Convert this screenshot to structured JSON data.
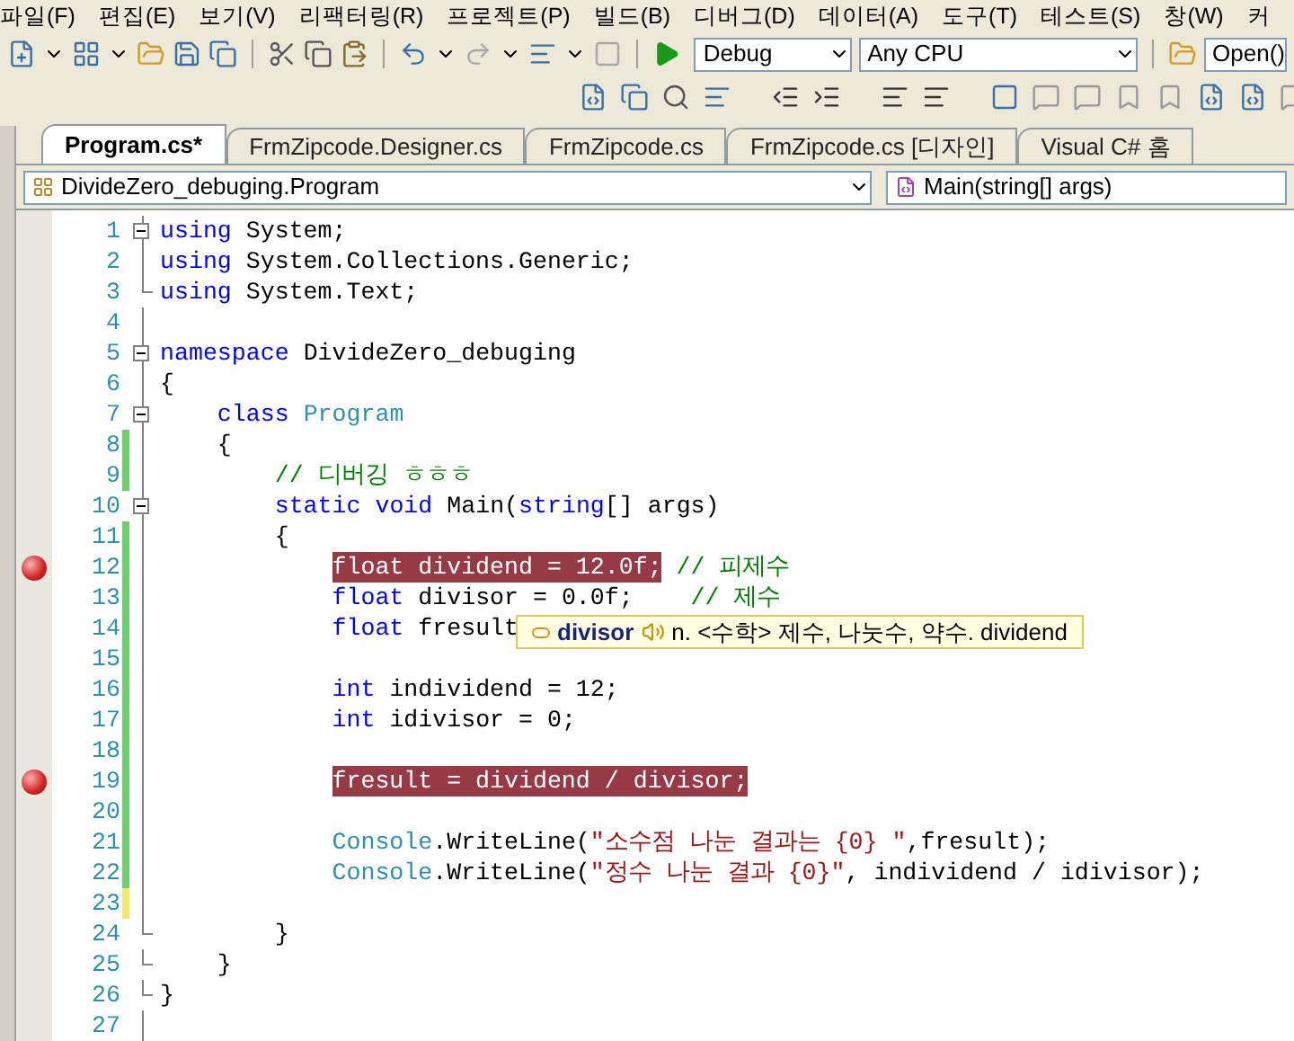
{
  "menu": [
    "파일(F)",
    "편집(E)",
    "보기(V)",
    "리팩터링(R)",
    "프로젝트(P)",
    "빌드(B)",
    "디버그(D)",
    "데이터(A)",
    "도구(T)",
    "테스트(S)",
    "창(W)",
    "커"
  ],
  "toolbar": {
    "configuration": "Debug",
    "platform": "Any CPU",
    "find_value": "Open()"
  },
  "tabs": [
    {
      "label": "Program.cs*",
      "selected": true
    },
    {
      "label": "FrmZipcode.Designer.cs",
      "selected": false
    },
    {
      "label": "FrmZipcode.cs",
      "selected": false
    },
    {
      "label": "FrmZipcode.cs [디자인]",
      "selected": false
    },
    {
      "label": "Visual C# 홈",
      "selected": false
    }
  ],
  "navigation": {
    "type": "DivideZero_debuging.Program",
    "member": "Main(string[] args)"
  },
  "lines": [
    {
      "number": "1",
      "collapsible": true,
      "block_end": false,
      "changed": false,
      "breakpoint": false,
      "tokens": [
        {
          "kind": "keyword",
          "text": "using"
        },
        {
          "kind": "plain",
          "text": " System;"
        }
      ]
    },
    {
      "number": "2",
      "collapsible": false,
      "block_end": false,
      "changed": false,
      "breakpoint": false,
      "tokens": [
        {
          "kind": "keyword",
          "text": "using"
        },
        {
          "kind": "plain",
          "text": " System.Collections.Generic;"
        }
      ]
    },
    {
      "number": "3",
      "collapsible": false,
      "block_end": true,
      "changed": false,
      "breakpoint": false,
      "tokens": [
        {
          "kind": "keyword",
          "text": "using"
        },
        {
          "kind": "plain",
          "text": " System.Text;"
        }
      ]
    },
    {
      "number": "4",
      "collapsible": false,
      "block_end": false,
      "changed": false,
      "breakpoint": false
    },
    {
      "number": "5",
      "collapsible": true,
      "block_end": false,
      "changed": false,
      "breakpoint": false,
      "tokens": [
        {
          "kind": "keyword",
          "text": "namespace"
        },
        {
          "kind": "plain",
          "text": " DivideZero_debuging"
        }
      ]
    },
    {
      "number": "6",
      "collapsible": false,
      "block_end": false,
      "changed": false,
      "breakpoint": false,
      "tokens": [
        {
          "kind": "plain",
          "text": "{"
        }
      ]
    },
    {
      "number": "7",
      "collapsible": true,
      "block_end": false,
      "changed": false,
      "breakpoint": false,
      "tokens": [
        {
          "kind": "keyword",
          "text": "    class"
        },
        {
          "kind": "type",
          "text": " Program"
        }
      ]
    },
    {
      "number": "8",
      "collapsible": false,
      "block_end": false,
      "changed": true,
      "saved": true,
      "breakpoint": false,
      "tokens": [
        {
          "kind": "plain",
          "text": "    {"
        }
      ]
    },
    {
      "number": "9",
      "collapsible": false,
      "block_end": false,
      "changed": true,
      "saved": true,
      "breakpoint": false,
      "tokens": [
        {
          "kind": "comment",
          "text": "        // 디버깅 ㅎㅎㅎ"
        }
      ]
    },
    {
      "number": "10",
      "collapsible": true,
      "block_end": false,
      "changed": false,
      "breakpoint": false,
      "tokens": [
        {
          "kind": "keyword",
          "text": "        static"
        },
        {
          "kind": "keyword",
          "text": " void"
        },
        {
          "kind": "plain",
          "text": " Main("
        },
        {
          "kind": "keyword",
          "text": "string"
        },
        {
          "kind": "plain",
          "text": "[] args)"
        }
      ]
    },
    {
      "number": "11",
      "collapsible": false,
      "block_end": false,
      "changed": true,
      "saved": true,
      "breakpoint": false,
      "tokens": [
        {
          "kind": "plain",
          "text": "        {"
        }
      ]
    },
    {
      "number": "12",
      "collapsible": false,
      "block_end": false,
      "changed": true,
      "saved": true,
      "breakpoint": true,
      "tokens": [
        {
          "kind": "breakpoint",
          "text": "            float dividend = 12.0f;"
        },
        {
          "kind": "comment",
          "text": " // 피제수"
        }
      ]
    },
    {
      "number": "13",
      "collapsible": false,
      "block_end": false,
      "changed": true,
      "saved": true,
      "breakpoint": false,
      "tokens": [
        {
          "kind": "keyword",
          "text": "            float"
        },
        {
          "kind": "plain",
          "text": " divisor = 0.0f;"
        },
        {
          "kind": "comment",
          "text": "    // 제수"
        }
      ]
    },
    {
      "number": "14",
      "collapsible": false,
      "block_end": false,
      "changed": true,
      "saved": true,
      "breakpoint": false,
      "tokens": [
        {
          "kind": "keyword",
          "text": "            float"
        },
        {
          "kind": "plain",
          "text": " fresult"
        }
      ]
    },
    {
      "number": "15",
      "collapsible": false,
      "block_end": false,
      "changed": true,
      "saved": true,
      "breakpoint": false
    },
    {
      "number": "16",
      "collapsible": false,
      "block_end": false,
      "changed": true,
      "saved": true,
      "breakpoint": false,
      "tokens": [
        {
          "kind": "keyword",
          "text": "            int"
        },
        {
          "kind": "plain",
          "text": " individend = 12;"
        }
      ]
    },
    {
      "number": "17",
      "collapsible": false,
      "block_end": false,
      "changed": true,
      "saved": true,
      "breakpoint": false,
      "tokens": [
        {
          "kind": "keyword",
          "text": "            int"
        },
        {
          "kind": "plain",
          "text": " idivisor = 0;"
        }
      ]
    },
    {
      "number": "18",
      "collapsible": false,
      "block_end": false,
      "changed": true,
      "saved": true,
      "breakpoint": false
    },
    {
      "number": "19",
      "collapsible": false,
      "block_end": false,
      "changed": true,
      "saved": true,
      "breakpoint": true,
      "tokens": [
        {
          "kind": "breakpoint",
          "text": "            fresult = dividend / divisor;"
        }
      ]
    },
    {
      "number": "20",
      "collapsible": false,
      "block_end": false,
      "changed": true,
      "saved": true,
      "breakpoint": false
    },
    {
      "number": "21",
      "collapsible": false,
      "block_end": false,
      "changed": true,
      "saved": true,
      "breakpoint": false,
      "tokens": [
        {
          "kind": "type",
          "text": "            Console"
        },
        {
          "kind": "plain",
          "text": ".WriteLine("
        },
        {
          "kind": "string",
          "text": "\"소수점 나눈 결과는 {0} \""
        },
        {
          "kind": "plain",
          "text": ",fresult);"
        }
      ]
    },
    {
      "number": "22",
      "collapsible": false,
      "block_end": false,
      "changed": true,
      "saved": true,
      "breakpoint": false,
      "tokens": [
        {
          "kind": "type",
          "text": "            Console"
        },
        {
          "kind": "plain",
          "text": ".WriteLine("
        },
        {
          "kind": "string",
          "text": "\"정수 나눈 결과 {0}\""
        },
        {
          "kind": "plain",
          "text": ", individend / idivisor);"
        }
      ]
    },
    {
      "number": "23",
      "collapsible": false,
      "block_end": false,
      "changed": true,
      "saved": false,
      "breakpoint": false
    },
    {
      "number": "24",
      "collapsible": false,
      "block_end": true,
      "changed": false,
      "breakpoint": false,
      "tokens": [
        {
          "kind": "plain",
          "text": "        }"
        }
      ]
    },
    {
      "number": "25",
      "collapsible": false,
      "block_end": true,
      "changed": false,
      "breakpoint": false,
      "tokens": [
        {
          "kind": "plain",
          "text": "    }"
        }
      ]
    },
    {
      "number": "26",
      "collapsible": false,
      "block_end": true,
      "changed": false,
      "breakpoint": false,
      "tokens": [
        {
          "kind": "plain",
          "text": "}"
        }
      ]
    },
    {
      "number": "27",
      "collapsible": false,
      "block_end": false,
      "changed": false,
      "breakpoint": false
    }
  ],
  "tooltip": {
    "word": "divisor",
    "definition": "n. <수학> 제수, 나눗수, 약수. dividend"
  }
}
